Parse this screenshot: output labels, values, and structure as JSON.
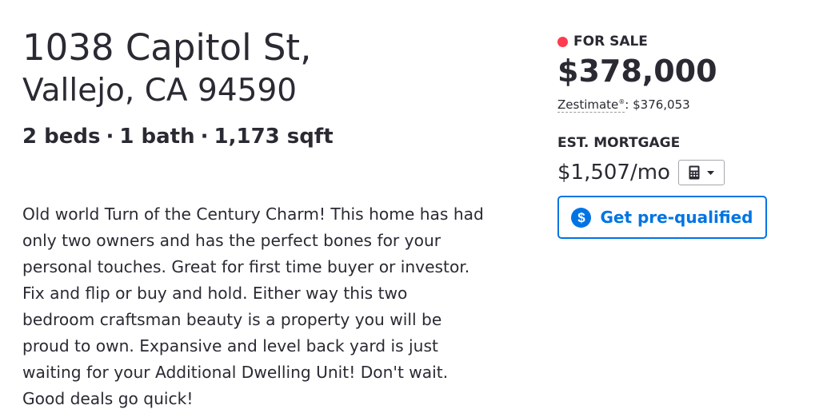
{
  "listing": {
    "address_line1": "1038 Capitol St,",
    "address_line2": "Vallejo, CA 94590",
    "facts": {
      "beds": "2 beds",
      "baths": "1 bath",
      "sqft": "1,173 sqft",
      "separator": "·"
    },
    "description_lines": [
      "Old world Turn of the Century Charm! This home has had",
      "only two owners and has the perfect bones for your",
      "personal touches. Great for first time buyer or investor.",
      "Fix and flip or buy and hold. Either way this two",
      "bedroom craftsman beauty is a property you will be",
      "proud to own. Expansive and level back yard is just",
      "waiting for your Additional Dwelling Unit! Don't wait.",
      "Good deals go quick!"
    ]
  },
  "summary": {
    "status": "FOR SALE",
    "status_color": "#ff3b4e",
    "price": "$378,000",
    "zestimate_label": "Zestimate",
    "zestimate_mark": "®",
    "zestimate_value": ": $376,053",
    "mortgage_label": "EST. MORTGAGE",
    "mortgage_value": "$1,507/mo",
    "calculator_icon": "calculator-icon",
    "dropdown_icon": "caret-down-icon",
    "prequal_icon": "dollar-circle-icon",
    "prequal_label": "Get pre-qualified",
    "accent_color": "#0074e4"
  }
}
